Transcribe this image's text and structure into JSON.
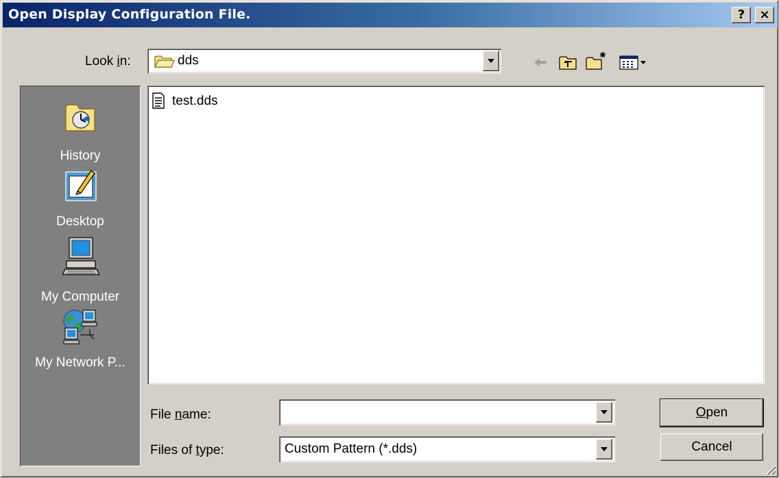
{
  "window": {
    "title": "Open Display Configuration File.",
    "help_label": "?",
    "close_label": "×"
  },
  "lookin": {
    "label_pre": "Look ",
    "label_key": "i",
    "label_post": "n:",
    "value": "dds"
  },
  "toolbar": {
    "back_icon": "back-arrow-icon",
    "up_icon": "up-folder-icon",
    "newfolder_icon": "new-folder-icon",
    "views_icon": "views-menu-icon"
  },
  "places": [
    {
      "label": "History",
      "icon": "history-icon"
    },
    {
      "label": "Desktop",
      "icon": "desktop-icon"
    },
    {
      "label": "My Computer",
      "icon": "my-computer-icon"
    },
    {
      "label": "My Network P...",
      "icon": "network-places-icon"
    }
  ],
  "files": [
    {
      "name": "test.dds",
      "icon": "text-file-icon"
    }
  ],
  "filename": {
    "label_pre": "File ",
    "label_key": "n",
    "label_post": "ame:",
    "value": ""
  },
  "filetype": {
    "label_pre": "Files of ",
    "label_key": "t",
    "label_post": "ype:",
    "value": "Custom Pattern (*.dds)"
  },
  "buttons": {
    "open_key": "O",
    "open_rest": "pen",
    "cancel": "Cancel"
  }
}
